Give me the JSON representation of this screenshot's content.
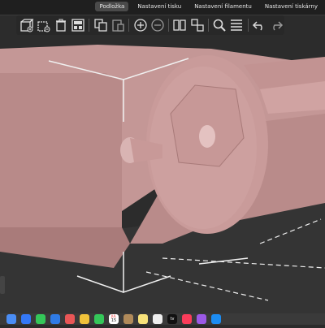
{
  "app": {
    "tabs": [
      {
        "label": "Podložka",
        "active": true
      },
      {
        "label": "Nastavení tisku",
        "active": false
      },
      {
        "label": "Nastavení filamentu",
        "active": false
      },
      {
        "label": "Nastavení tiskárny",
        "active": false
      }
    ]
  },
  "toolbar": {
    "icons": [
      "add-object-icon",
      "delete-icon",
      "delete-all-icon",
      "arrange-icon",
      "copy-icon",
      "paste-icon",
      "add-instance-icon",
      "remove-instance-icon",
      "split-objects-icon",
      "split-parts-icon",
      "layers-editing-icon",
      "search-icon",
      "layer-list-icon",
      "undo-icon",
      "redo-icon"
    ]
  },
  "scene": {
    "model_color": "#c99b9a",
    "bed_color": "#2f2f2f"
  },
  "dock": {
    "calendar_month": "JUL",
    "calendar_day": "15",
    "tv_label": "tv"
  }
}
